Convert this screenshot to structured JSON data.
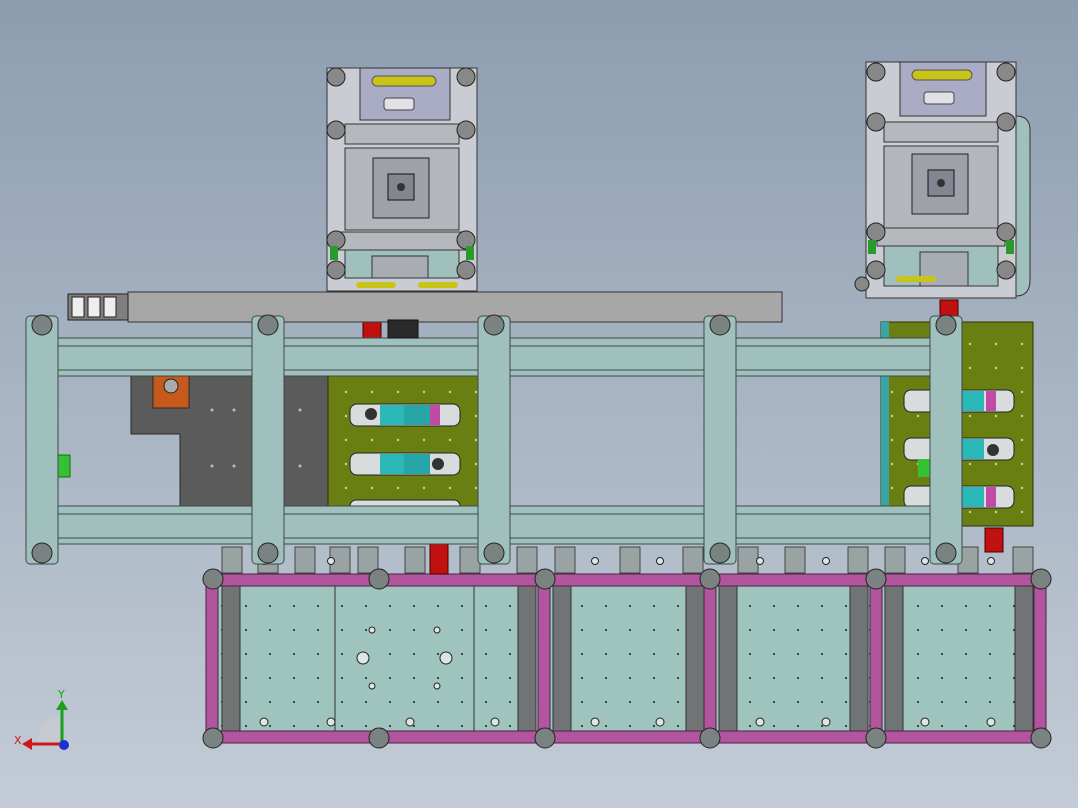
{
  "viewport": {
    "background_top": "#8d9db0",
    "background_bottom": "#c3ccd6"
  },
  "triad": {
    "y_label": "Y",
    "x_label": "X",
    "y_color": "#1aa01a",
    "x_color": "#d01818",
    "z_color": "#1c2fd0"
  },
  "colors": {
    "frame_teal": "#9fc0bd",
    "frame_edge": "#3c4a4a",
    "olive_plate": "#6a7f12",
    "magenta_frame": "#b0559e",
    "dark_gray": "#5d5d5d",
    "beam_gray": "#a7a7a7",
    "red_part": "#c01010",
    "cyan_block": "#2ab8b8",
    "orange_part": "#c55a1c"
  }
}
